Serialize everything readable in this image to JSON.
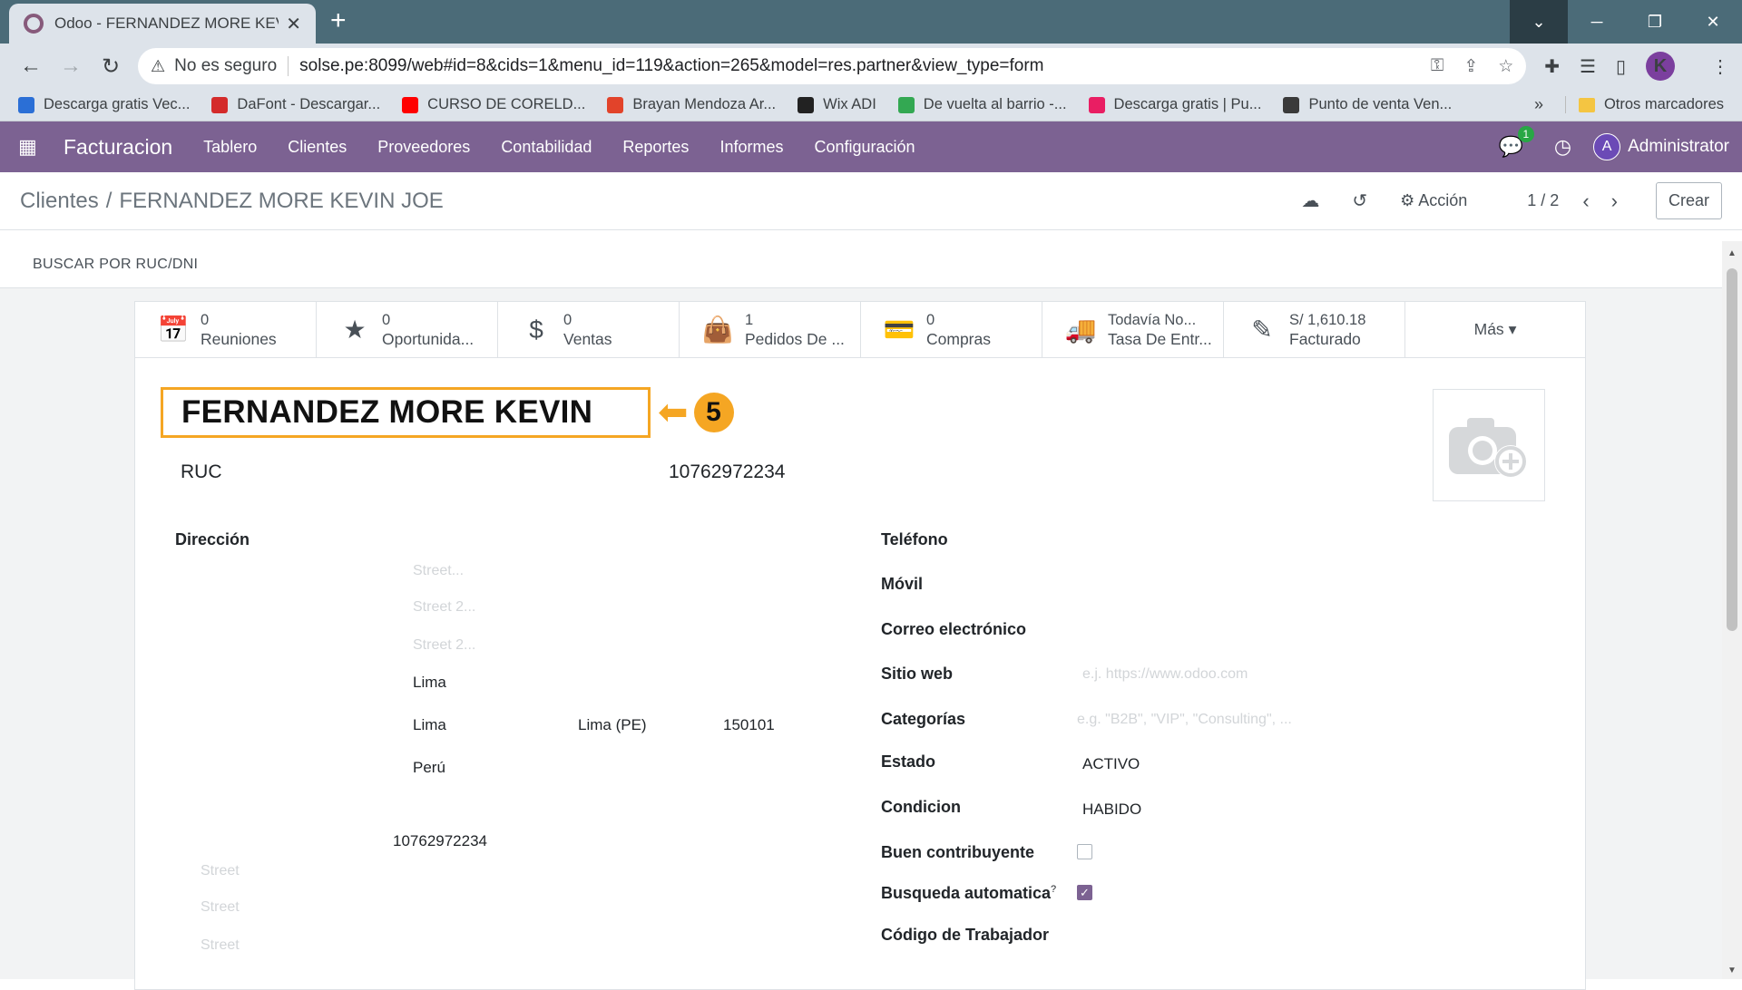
{
  "browser": {
    "tab_title": "Odoo - FERNANDEZ MORE KEVI",
    "security": "No es seguro",
    "url": "solse.pe:8099/web#id=8&cids=1&menu_id=119&action=265&model=res.partner&view_type=form",
    "profile_initial": "K",
    "bookmarks": [
      {
        "label": "Descarga gratis Vec...",
        "color": "#2b6fd6"
      },
      {
        "label": "DaFont - Descargar...",
        "color": "#d42b2b"
      },
      {
        "label": "CURSO DE CORELD...",
        "color": "#ff0000"
      },
      {
        "label": "Brayan Mendoza Ar...",
        "color": "#e2432a"
      },
      {
        "label": "Wix ADI",
        "color": "#222222"
      },
      {
        "label": "De vuelta al barrio -...",
        "color": "#33a852"
      },
      {
        "label": "Descarga gratis | Pu...",
        "color": "#e91e63"
      },
      {
        "label": "Punto de venta Ven...",
        "color": "#3a3a3a"
      }
    ],
    "bookmarks_more": "»",
    "other_bookmarks": "Otros marcadores"
  },
  "odoo_nav": {
    "app": "Facturacion",
    "menus": [
      "Tablero",
      "Clientes",
      "Proveedores",
      "Contabilidad",
      "Reportes",
      "Informes",
      "Configuración"
    ],
    "chat_count": "1",
    "avatar_initial": "A",
    "user": "Administrator"
  },
  "control": {
    "breadcrumb_parent": "Clientes",
    "breadcrumb_sep": "/",
    "breadcrumb_current": "FERNANDEZ MORE KEVIN JOE",
    "action": "Acción",
    "pager": "1 / 2",
    "create": "Crear"
  },
  "status_button": "BUSCAR POR RUC/DNI",
  "smart_buttons": [
    {
      "icon": "calendar-icon",
      "glyph": "📅",
      "value": "0",
      "label": "Reuniones"
    },
    {
      "icon": "star-icon",
      "glyph": "★",
      "value": "0",
      "label": "Oportunida..."
    },
    {
      "icon": "dollar-icon",
      "glyph": "$",
      "value": "0",
      "label": "Ventas"
    },
    {
      "icon": "bag-icon",
      "glyph": "👜",
      "value": "1",
      "label": "Pedidos De ..."
    },
    {
      "icon": "credit-card-icon",
      "glyph": "💳",
      "value": "0",
      "label": "Compras"
    },
    {
      "icon": "truck-icon",
      "glyph": "🚚",
      "value": "Todavía No...",
      "label": "Tasa De Entr..."
    },
    {
      "icon": "edit-icon",
      "glyph": "✎",
      "value": "S/ 1,610.18",
      "label": "Facturado"
    }
  ],
  "more": "Más",
  "partner": {
    "name": "FERNANDEZ MORE KEVIN",
    "callout_number": "5",
    "doc_type": "RUC",
    "doc_number": "10762972234"
  },
  "address": {
    "label": "Dirección",
    "street_placeholder": "Street...",
    "street2_placeholder": "Street 2...",
    "street3_placeholder": "Street 2...",
    "district": "Lima",
    "city": "Lima",
    "state": "Lima (PE)",
    "zip": "150101",
    "country": "Perú",
    "vat": "10762972234",
    "street_a": "Street",
    "street_b": "Street",
    "street_c": "Street"
  },
  "right_fields": {
    "phone_label": "Teléfono",
    "mobile_label": "Móvil",
    "email_label": "Correo electrónico",
    "website_label": "Sitio web",
    "website_placeholder": "e.j. https://www.odoo.com",
    "categories_label": "Categorías",
    "categories_placeholder": "e.g. \"B2B\", \"VIP\", \"Consulting\", ...",
    "state_label": "Estado",
    "state_value": "ACTIVO",
    "condition_label": "Condicion",
    "condition_value": "HABIDO",
    "good_taxpayer_label": "Buen contribuyente",
    "good_taxpayer": false,
    "auto_search_label": "Busqueda automatica",
    "auto_search_help": "?",
    "auto_search": true,
    "worker_code_label": "Código de Trabajador"
  }
}
